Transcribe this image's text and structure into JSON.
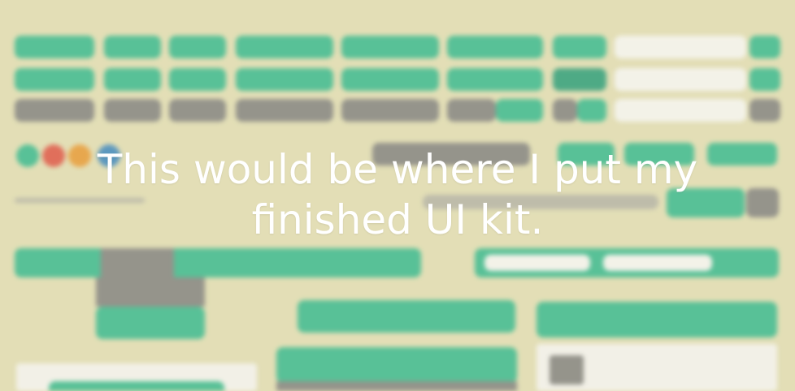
{
  "overlay": {
    "line1": "This would be where I put my",
    "line2": "finished UI kit."
  },
  "colors": {
    "background": "#e3dfb7",
    "accent_green": "#45bd93",
    "accent_green_dark": "#3aa37f",
    "neutral_gray": "#8a8a86",
    "panel_white": "#f4f3ee",
    "red": "#e0604f",
    "orange": "#e8a040",
    "blue": "#4a8fc0"
  }
}
